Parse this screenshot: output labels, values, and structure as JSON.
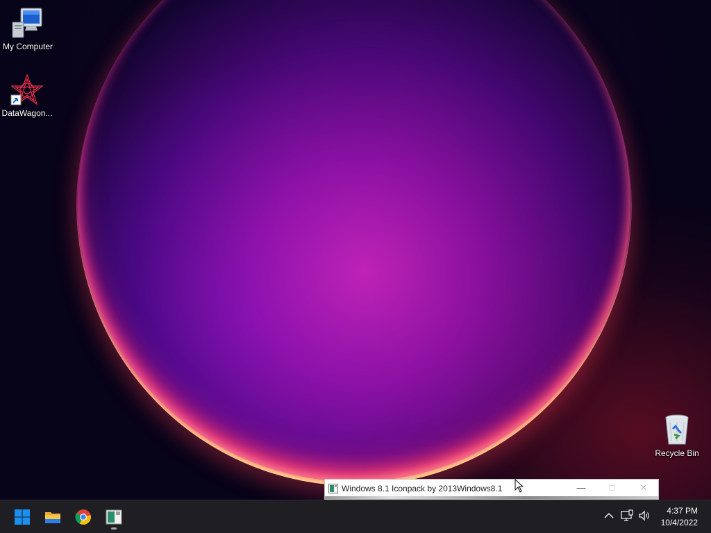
{
  "desktop": {
    "icons": [
      {
        "label": "My Computer",
        "icon": "my-computer-icon"
      },
      {
        "label": "DataWagon...",
        "icon": "datawagon-shortcut-icon"
      },
      {
        "label": "Recycle Bin",
        "icon": "recycle-bin-icon"
      }
    ]
  },
  "window": {
    "title": "Windows 8.1 Iconpack by 2013Windows8.1",
    "minimize_glyph": "—",
    "maximize_glyph": "□",
    "close_glyph": "✕"
  },
  "taskbar": {
    "pinned": [
      {
        "name": "start-button",
        "icon": "windows-logo-icon"
      },
      {
        "name": "file-explorer-button",
        "icon": "folder-icon"
      },
      {
        "name": "chrome-button",
        "icon": "chrome-icon"
      },
      {
        "name": "iconpack-app-button",
        "icon": "iconpack-app-icon",
        "running": true
      }
    ],
    "tray": {
      "overflow_glyph": "^",
      "network_icon": "network-icon",
      "volume_icon": "volume-icon"
    },
    "clock": {
      "time": "4:37 PM",
      "date": "10/4/2022"
    }
  },
  "colors": {
    "taskbar_bg": "#1f1f23",
    "accent_blue": "#1a8ff0",
    "wallpaper_glow": "#d92cd0"
  }
}
